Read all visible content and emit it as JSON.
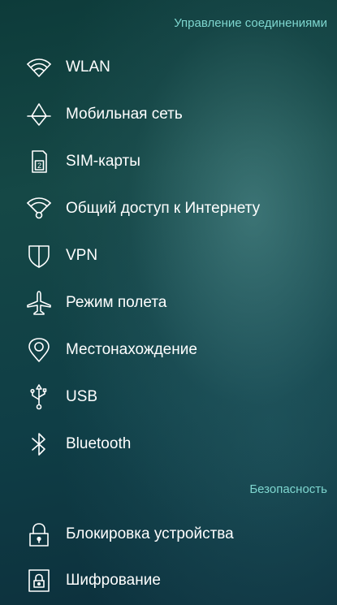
{
  "sections": {
    "connections_header": "Управление соединениями",
    "security_header": "Безопасность"
  },
  "items": [
    {
      "label": "WLAN",
      "icon": "wifi-icon"
    },
    {
      "label": "Мобильная сеть",
      "icon": "mobile-network-icon"
    },
    {
      "label": "SIM-карты",
      "icon": "sim-card-icon",
      "icon_text": "2"
    },
    {
      "label": "Общий доступ к Интернету",
      "icon": "hotspot-icon"
    },
    {
      "label": "VPN",
      "icon": "shield-icon"
    },
    {
      "label": "Режим полета",
      "icon": "airplane-icon"
    },
    {
      "label": "Местонахождение",
      "icon": "location-pin-icon"
    },
    {
      "label": "USB",
      "icon": "usb-icon"
    },
    {
      "label": "Bluetooth",
      "icon": "bluetooth-icon"
    },
    {
      "label": "Блокировка устройства",
      "icon": "lock-icon"
    },
    {
      "label": "Шифрование",
      "icon": "encryption-lock-icon"
    }
  ],
  "colors": {
    "section_header": "#7ed6cf",
    "text": "#ffffff",
    "background": "#0f3e46"
  }
}
